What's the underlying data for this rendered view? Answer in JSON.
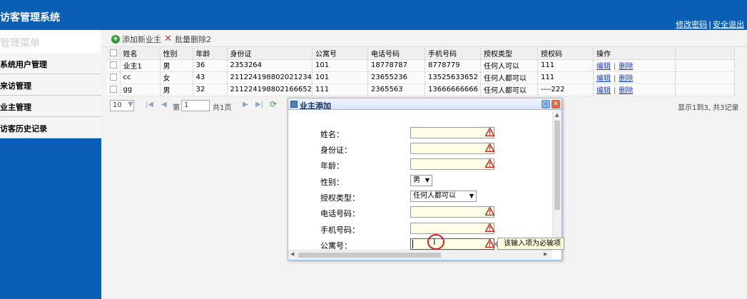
{
  "header": {
    "title": "访客管理系统",
    "links": [
      "修改密码",
      "安全退出"
    ],
    "link_separator": "|"
  },
  "sidebar": {
    "title": "管理菜单",
    "items": [
      "系统用户管理",
      "来访管理",
      "业主管理",
      "访客历史记录"
    ]
  },
  "toolbar": {
    "add_label": "添加新业主",
    "batch_delete_label": "批量删除2"
  },
  "table": {
    "columns": [
      "姓名",
      "性别",
      "年龄",
      "身份证",
      "公寓号",
      "电话号码",
      "手机号码",
      "授权类型",
      "授权码",
      "操作"
    ],
    "rows": [
      [
        "业主1",
        "男",
        "36",
        "2353264",
        "101",
        "18778787",
        "8778779",
        "任何人可以",
        "111"
      ],
      [
        "cc",
        "女",
        "43",
        "211224198802021234",
        "101",
        "23655236",
        "13525633652",
        "任何人都可以",
        "111"
      ],
      [
        "gg",
        "男",
        "32",
        "211224198802166652",
        "111",
        "2365563",
        "13666666666",
        "任何人都可以",
        "----222"
      ]
    ],
    "actions": {
      "edit": "编辑",
      "delete": "删除",
      "separator": "|"
    }
  },
  "pager": {
    "page_size": "10",
    "page_prefix": "第",
    "page_value": "1",
    "page_suffix": "共1页",
    "summary": "显示1到3, 共3记录"
  },
  "dialog": {
    "title": "业主添加",
    "fields": [
      {
        "label": "姓名：",
        "type": "text",
        "value": ""
      },
      {
        "label": "身份证：",
        "type": "text",
        "value": ""
      },
      {
        "label": "年龄：",
        "type": "text",
        "value": ""
      },
      {
        "label": "性别：",
        "type": "select",
        "value": "男"
      },
      {
        "label": "授权类型：",
        "type": "select",
        "value": "任何人都可以"
      },
      {
        "label": "电话号码：",
        "type": "text",
        "value": ""
      },
      {
        "label": "手机号码：",
        "type": "text",
        "value": ""
      },
      {
        "label": "公寓号：",
        "type": "text",
        "value": ""
      }
    ],
    "validation_tip": "该输入项为必输项"
  },
  "colors": {
    "brand": "#0a5fb4",
    "required_bg": "#fffde6",
    "warn": "#d42020",
    "link": "#1a3fbd"
  }
}
